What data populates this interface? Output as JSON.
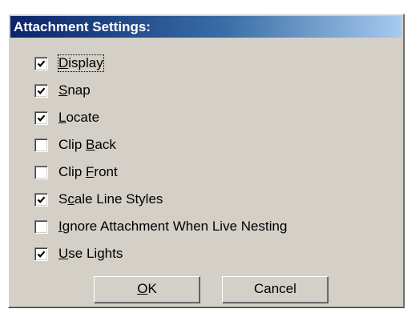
{
  "dialog": {
    "title": "Attachment Settings:"
  },
  "options": [
    {
      "mnemonic": "D",
      "rest": "isplay",
      "prefix": "",
      "checked": true,
      "focused": true
    },
    {
      "mnemonic": "S",
      "rest": "nap",
      "prefix": "",
      "checked": true
    },
    {
      "mnemonic": "L",
      "rest": "ocate",
      "prefix": "",
      "checked": true
    },
    {
      "prefix": "Clip ",
      "mnemonic": "B",
      "rest": "ack",
      "checked": false
    },
    {
      "prefix": "Clip ",
      "mnemonic": "F",
      "rest": "ront",
      "checked": false
    },
    {
      "prefix": "S",
      "mnemonic": "c",
      "rest": "ale Line Styles",
      "checked": true
    },
    {
      "prefix": "",
      "mnemonic": "I",
      "rest": "gnore Attachment When Live Nesting",
      "checked": false
    },
    {
      "prefix": "",
      "mnemonic": "U",
      "rest": "se Lights",
      "checked": true
    }
  ],
  "buttons": {
    "ok_mnemonic": "O",
    "ok_rest": "K",
    "cancel_label": "Cancel"
  }
}
